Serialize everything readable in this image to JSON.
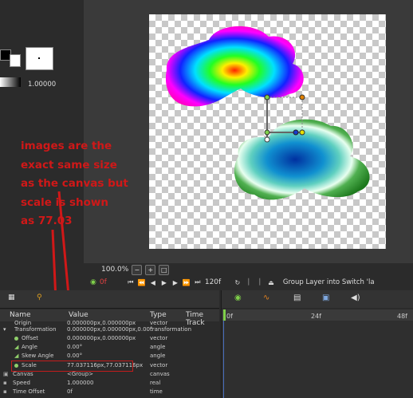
{
  "toolbox": {
    "brush_size_value": "1.00000"
  },
  "annotation": {
    "lines": [
      "images are the",
      "exact same size",
      "as the canvas but",
      "scale is shown",
      "as 77.03"
    ],
    "color": "#d01818"
  },
  "zoom": {
    "value": "100.0%",
    "minus_icon": "zoom-out-icon",
    "plus_icon": "zoom-in-icon",
    "fit_icon": "zoom-fit-icon"
  },
  "playbar": {
    "current_frame": "0f",
    "end_frame": "120f",
    "status": "Group Layer into Switch 'la"
  },
  "params": {
    "headers": {
      "name": "Name",
      "value": "Value",
      "type": "Type",
      "time_track": "Time Track"
    },
    "rows": [
      {
        "name": "Origin",
        "value": "0.000000px,0.000000px",
        "type": "vector"
      },
      {
        "name": "Transformation",
        "value": "0.000000px,0.000000px,0.00°",
        "type": "transformation"
      },
      {
        "name": "Offset",
        "value": "0.000000px,0.000000px",
        "type": "vector"
      },
      {
        "name": "Angle",
        "value": "0.00°",
        "type": "angle"
      },
      {
        "name": "Skew Angle",
        "value": "0.00°",
        "type": "angle"
      },
      {
        "name": "Scale",
        "value": "77.037116px,77.037116px",
        "type": "vector"
      },
      {
        "name": "Canvas",
        "value": "<Group>",
        "type": "canvas"
      },
      {
        "name": "Speed",
        "value": "1.000000",
        "type": "real"
      },
      {
        "name": "Time Offset",
        "value": "0f",
        "type": "time"
      }
    ]
  },
  "timetrack": {
    "ruler_ticks": [
      "0f",
      "24f",
      "48f"
    ]
  },
  "colors": {
    "annotation_red": "#d01818",
    "highlight_box": "#c41c1c",
    "play_green": "#7fd04a"
  }
}
